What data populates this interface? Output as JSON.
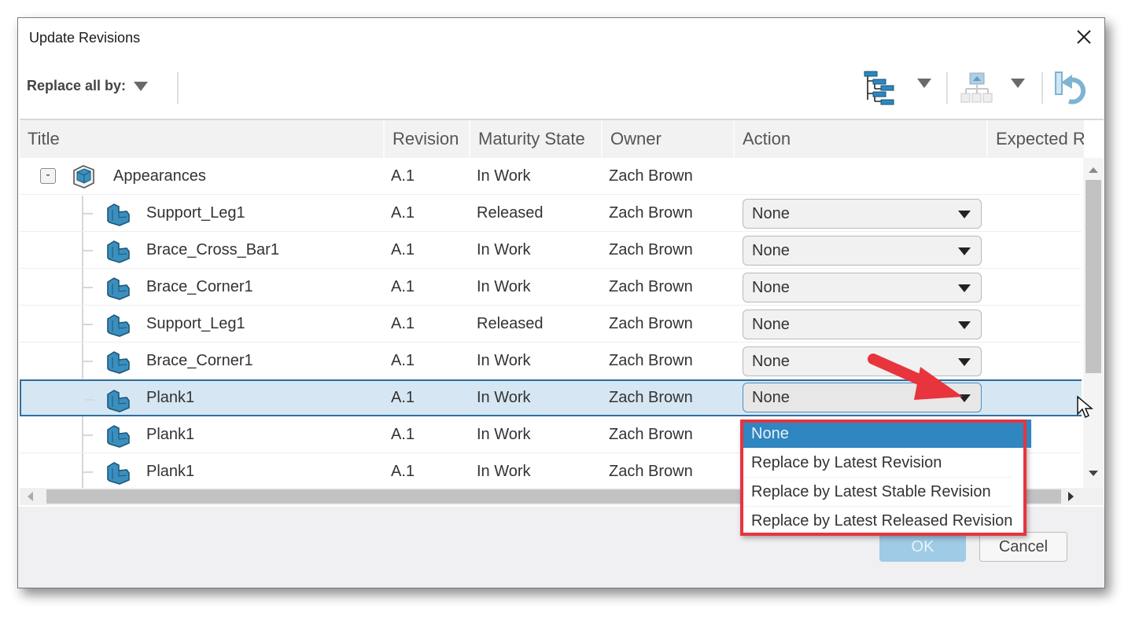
{
  "dialog": {
    "title": "Update Revisions",
    "close_icon": "close-icon"
  },
  "toolbar": {
    "replace_all_label": "Replace all by:",
    "icons": [
      "tree-structure-icon",
      "chevron-down-icon",
      "hierarchy-icon",
      "chevron-down-icon",
      "revert-icon"
    ]
  },
  "grid": {
    "columns": [
      "Title",
      "Revision",
      "Maturity State",
      "Owner",
      "Action",
      "Expected R..."
    ],
    "rows": [
      {
        "title": "Appearances",
        "revision": "A.1",
        "maturity": "In Work",
        "owner": "Zach Brown",
        "action": "",
        "is_parent": true,
        "expander": "-"
      },
      {
        "title": "Support_Leg1",
        "revision": "A.1",
        "maturity": "Released",
        "owner": "Zach Brown",
        "action": "None"
      },
      {
        "title": "Brace_Cross_Bar1",
        "revision": "A.1",
        "maturity": "In Work",
        "owner": "Zach Brown",
        "action": "None"
      },
      {
        "title": "Brace_Corner1",
        "revision": "A.1",
        "maturity": "In Work",
        "owner": "Zach Brown",
        "action": "None"
      },
      {
        "title": "Support_Leg1",
        "revision": "A.1",
        "maturity": "Released",
        "owner": "Zach Brown",
        "action": "None"
      },
      {
        "title": "Brace_Corner1",
        "revision": "A.1",
        "maturity": "In Work",
        "owner": "Zach Brown",
        "action": "None"
      },
      {
        "title": "Plank1",
        "revision": "A.1",
        "maturity": "In Work",
        "owner": "Zach Brown",
        "action": "None",
        "selected": true
      },
      {
        "title": "Plank1",
        "revision": "A.1",
        "maturity": "In Work",
        "owner": "Zach Brown",
        "action": ""
      },
      {
        "title": "Plank1",
        "revision": "A.1",
        "maturity": "In Work",
        "owner": "Zach Brown",
        "action": ""
      }
    ]
  },
  "dropdown": {
    "options": [
      "None",
      "Replace by Latest Revision",
      "Replace by Latest Stable Revision",
      "Replace by Latest Released Revision"
    ],
    "selected": "None"
  },
  "footer": {
    "ok_label": "OK",
    "cancel_label": "Cancel"
  },
  "colors": {
    "selection": "#2f86c0",
    "row_selected": "#d6e7f3",
    "annotation": "#e8343d",
    "icon_blue": "#3b8fbf"
  }
}
